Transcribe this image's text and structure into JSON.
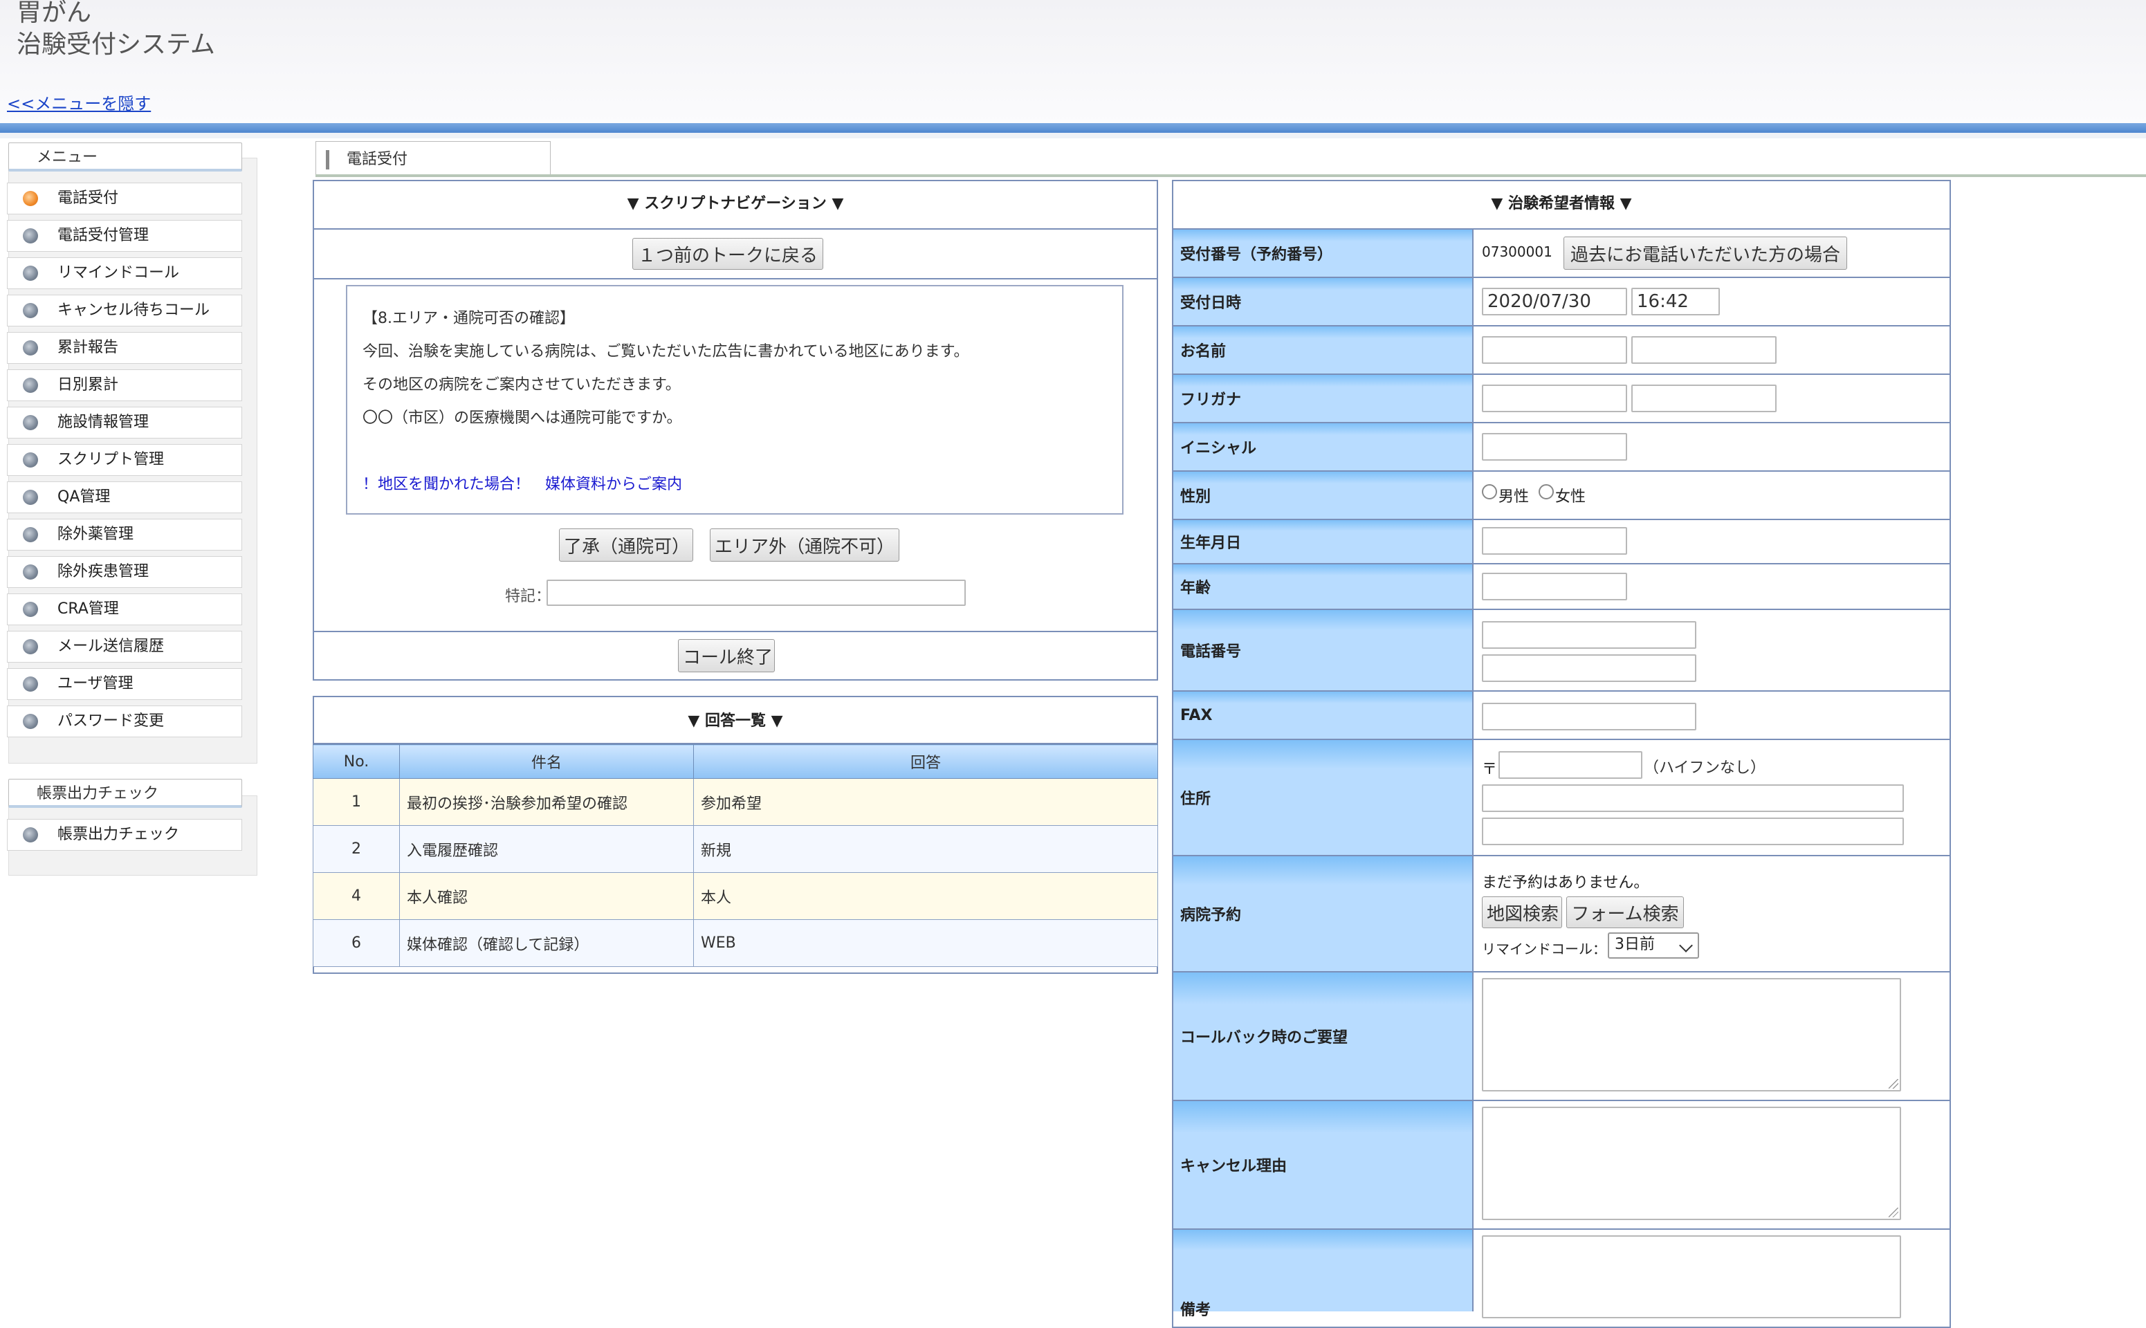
{
  "header": {
    "title_line1": "胃がん",
    "title_line2": "治験受付システム",
    "hide_menu_link": "<<メニューを隠す"
  },
  "sidebar": {
    "menu_title": "メニュー",
    "items": [
      {
        "label": "電話受付",
        "active": true
      },
      {
        "label": "電話受付管理"
      },
      {
        "label": "リマインドコール"
      },
      {
        "label": "キャンセル待ちコール"
      },
      {
        "label": "累計報告"
      },
      {
        "label": "日別累計"
      },
      {
        "label": "施設情報管理"
      },
      {
        "label": "スクリプト管理"
      },
      {
        "label": "QA管理"
      },
      {
        "label": "除外薬管理"
      },
      {
        "label": "除外疾患管理"
      },
      {
        "label": "CRA管理"
      },
      {
        "label": "メール送信履歴"
      },
      {
        "label": "ユーザ管理"
      },
      {
        "label": "パスワード変更"
      }
    ],
    "report_title": "帳票出力チェック",
    "report_items": [
      {
        "label": "帳票出力チェック"
      }
    ]
  },
  "main_tab": {
    "label": "電話受付"
  },
  "script_nav": {
    "title": "▼ スクリプトナビゲーション ▼",
    "back_button": "１つ前のトークに戻る",
    "lines": [
      "【8.エリア・通院可否の確認】",
      "今回、治験を実施している病院は、ご覧いただいた広告に書かれている地区にあります。",
      "その地区の病院をご案内させていただきます。",
      "〇〇（市区）の医療機関へは通院可能ですか。"
    ],
    "note_link": "！地区を聞かれた場合！　媒体資料からご案内",
    "ok_button": "了承（通院可）",
    "ng_button": "エリア外（通院不可）",
    "remarks_label": "特記：",
    "remarks_value": "",
    "end_call_button": "コール終了"
  },
  "answers": {
    "title": "▼ 回答一覧 ▼",
    "columns": [
      "No.",
      "件名",
      "回答"
    ],
    "rows": [
      {
        "no": "1",
        "subject": "最初の挨拶･治験参加希望の確認",
        "answer": "参加希望"
      },
      {
        "no": "2",
        "subject": "入電履歴確認",
        "answer": "新規"
      },
      {
        "no": "4",
        "subject": "本人確認",
        "answer": "本人"
      },
      {
        "no": "6",
        "subject": "媒体確認（確認して記録）",
        "answer": "WEB"
      }
    ]
  },
  "applicant": {
    "title": "▼ 治験希望者情報 ▼",
    "labels": {
      "reception_no": "受付番号（予約番号）",
      "reception_date": "受付日時",
      "name": "お名前",
      "furigana": "フリガナ",
      "initial": "イニシャル",
      "gender": "性別",
      "birthdate": "生年月日",
      "age": "年齢",
      "phone": "電話番号",
      "fax": "FAX",
      "address": "住所",
      "hospital": "病院予約",
      "callback": "コールバック時のご要望",
      "cancel_reason": "キャンセル理由",
      "notes": "備考"
    },
    "reception_no_value": "07300001",
    "past_caller_button": "過去にお電話いただいた方の場合",
    "date_value": "2020/07/30",
    "time_value": "16:42",
    "gender_male": "男性",
    "gender_female": "女性",
    "postal_prefix": "〒",
    "postal_note": "（ハイフンなし）",
    "hospital_status": "まだ予約はありません。",
    "map_search_button": "地図検索",
    "form_search_button": "フォーム検索",
    "remind_label": "リマインドコール：",
    "remind_value": "3日前"
  }
}
